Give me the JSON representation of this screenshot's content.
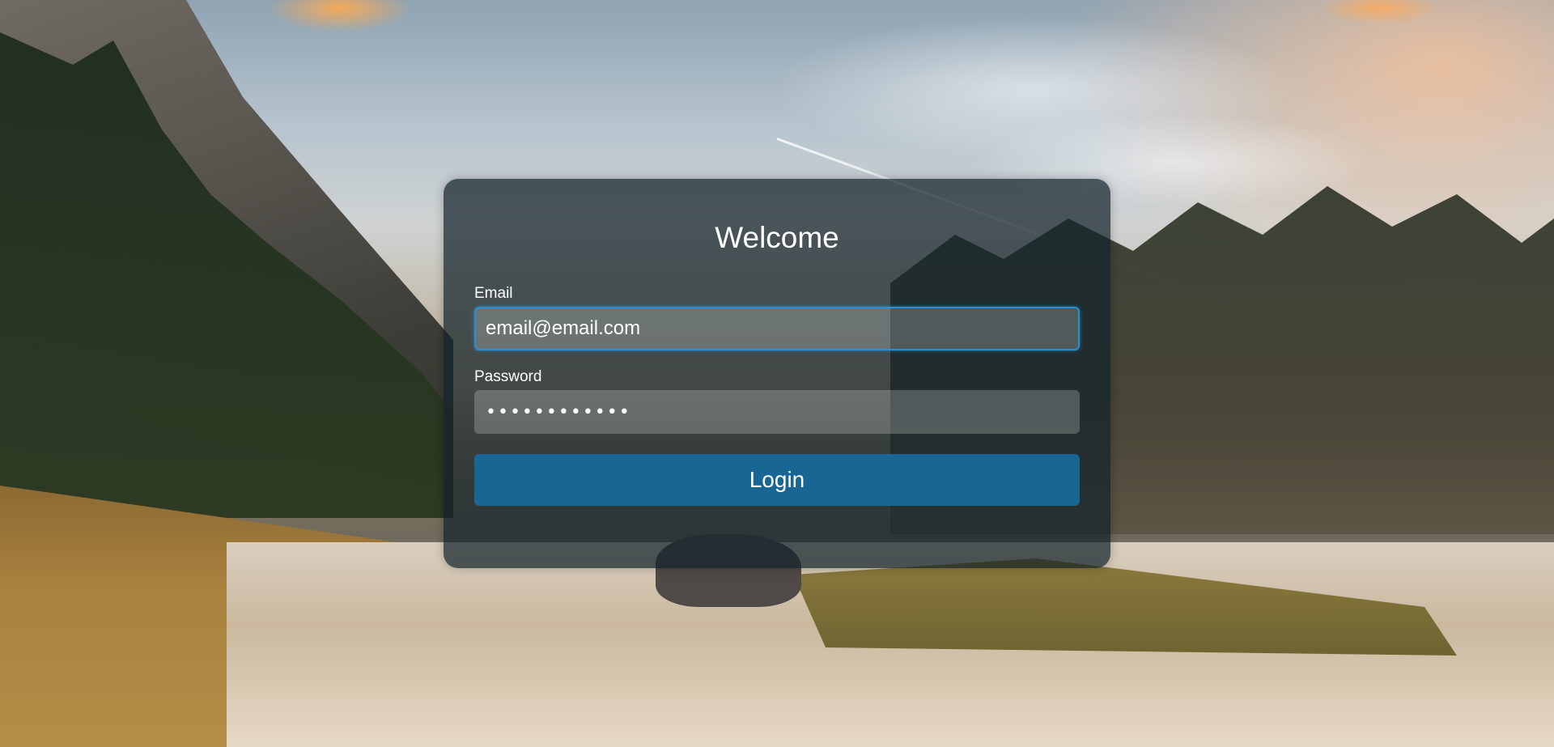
{
  "login": {
    "title": "Welcome",
    "email_label": "Email",
    "email_value": "email@email.com",
    "password_label": "Password",
    "password_value": "••••••••••••",
    "button_label": "Login"
  },
  "colors": {
    "card_background": "#14222a",
    "button_background": "#146ea5",
    "focus_border": "#2a8fd0",
    "text": "#ffffff"
  }
}
